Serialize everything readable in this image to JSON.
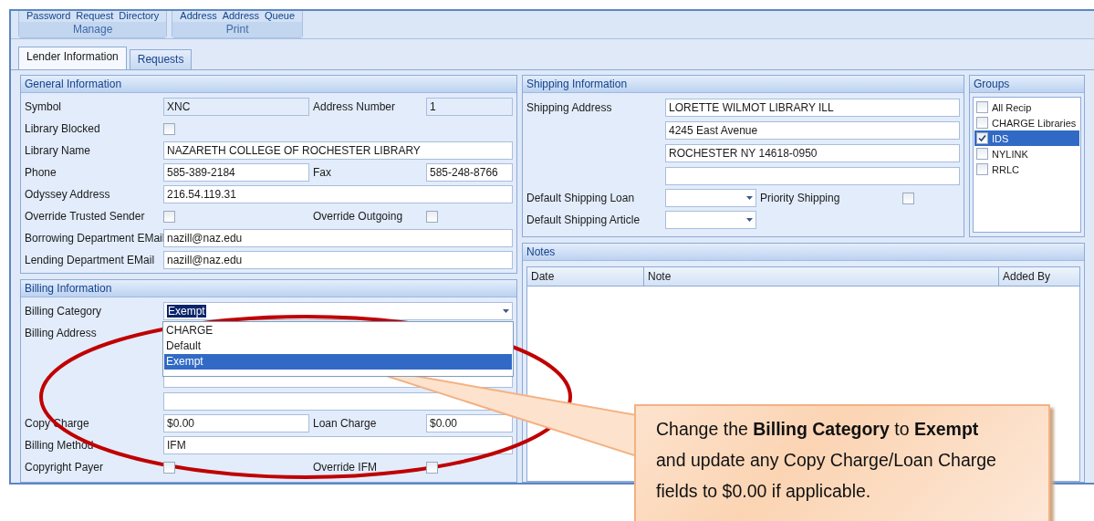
{
  "ribbon": {
    "groups": [
      {
        "items": [
          "Password",
          "Request",
          "Directory"
        ],
        "label": "Manage"
      },
      {
        "items": [
          "Address",
          "Address",
          "Queue"
        ],
        "label": "Print"
      }
    ]
  },
  "tabs": [
    {
      "label": "Lender Information",
      "selected": true
    },
    {
      "label": "Requests",
      "selected": false
    }
  ],
  "general_information": {
    "title": "General Information",
    "rows": [
      {
        "kind": "double",
        "label": "Symbol",
        "value": "XNC",
        "readonly": true,
        "label_2": "Address Number",
        "value_2": "1",
        "readonly_2": true
      },
      {
        "kind": "check",
        "label": "Library Blocked",
        "checked": false
      },
      {
        "kind": "single",
        "label": "Library Name",
        "value": "NAZARETH COLLEGE OF ROCHESTER LIBRARY"
      },
      {
        "kind": "double",
        "label": "Phone",
        "value": "585-389-2184",
        "readonly": false,
        "label_2": "Fax",
        "value_2": "585-248-8766",
        "readonly_2": false
      },
      {
        "kind": "single",
        "label": "Odyssey Address",
        "value": "216.54.119.31"
      },
      {
        "kind": "check_pair",
        "label": "Override Trusted Sender",
        "checked": false,
        "label_2": "Override Outgoing",
        "checked_2": false
      },
      {
        "kind": "single",
        "label": "Borrowing Department EMail",
        "value": "nazill@naz.edu"
      },
      {
        "kind": "single",
        "label": "Lending Department EMail",
        "value": "nazill@naz.edu"
      }
    ]
  },
  "billing_information": {
    "title": "Billing Information",
    "rows": [
      {
        "kind": "dropdown",
        "label": "Billing Category",
        "value": "Exempt",
        "options": [
          {
            "label": "CHARGE",
            "selected": false
          },
          {
            "label": "Default",
            "selected": false
          },
          {
            "label": "Exempt",
            "selected": true
          }
        ]
      },
      {
        "kind": "address",
        "label": "Billing Address"
      },
      {
        "kind": "double",
        "label": "Copy Charge",
        "value": "$0.00",
        "readonly": false,
        "label_2": "Loan Charge",
        "value_2": "$0.00",
        "readonly_2": false
      },
      {
        "kind": "single",
        "label": "Billing Method",
        "value": "IFM"
      },
      {
        "kind": "check_pair",
        "label": "Copyright Payer",
        "checked": false,
        "label_2": "Override IFM",
        "checked_2": false
      }
    ]
  },
  "shipping_information": {
    "title": "Shipping Information",
    "address_label": "Shipping Address",
    "address_lines": [
      "LORETTE WILMOT LIBRARY ILL",
      "4245 East Avenue",
      "ROCHESTER NY 14618-0950"
    ],
    "default_loan_label": "Default Shipping Loan",
    "priority_label": "Priority Shipping",
    "priority_checked": false,
    "default_article_label": "Default Shipping Article"
  },
  "groups": {
    "title": "Groups",
    "items": [
      {
        "label": "All Recip",
        "checked": false,
        "selected": false
      },
      {
        "label": "CHARGE Libraries",
        "checked": false,
        "selected": false
      },
      {
        "label": "IDS",
        "checked": true,
        "selected": true
      },
      {
        "label": "NYLINK",
        "checked": false,
        "selected": false
      },
      {
        "label": "RRLC",
        "checked": false,
        "selected": false
      }
    ]
  },
  "notes": {
    "title": "Notes",
    "columns": [
      "Date",
      "Note",
      "Added By"
    ]
  },
  "callout": {
    "text": "Change the **Billing Category** to **Exempt** and update any Copy Charge/Loan Charge fields to $0.00 if applicable."
  }
}
